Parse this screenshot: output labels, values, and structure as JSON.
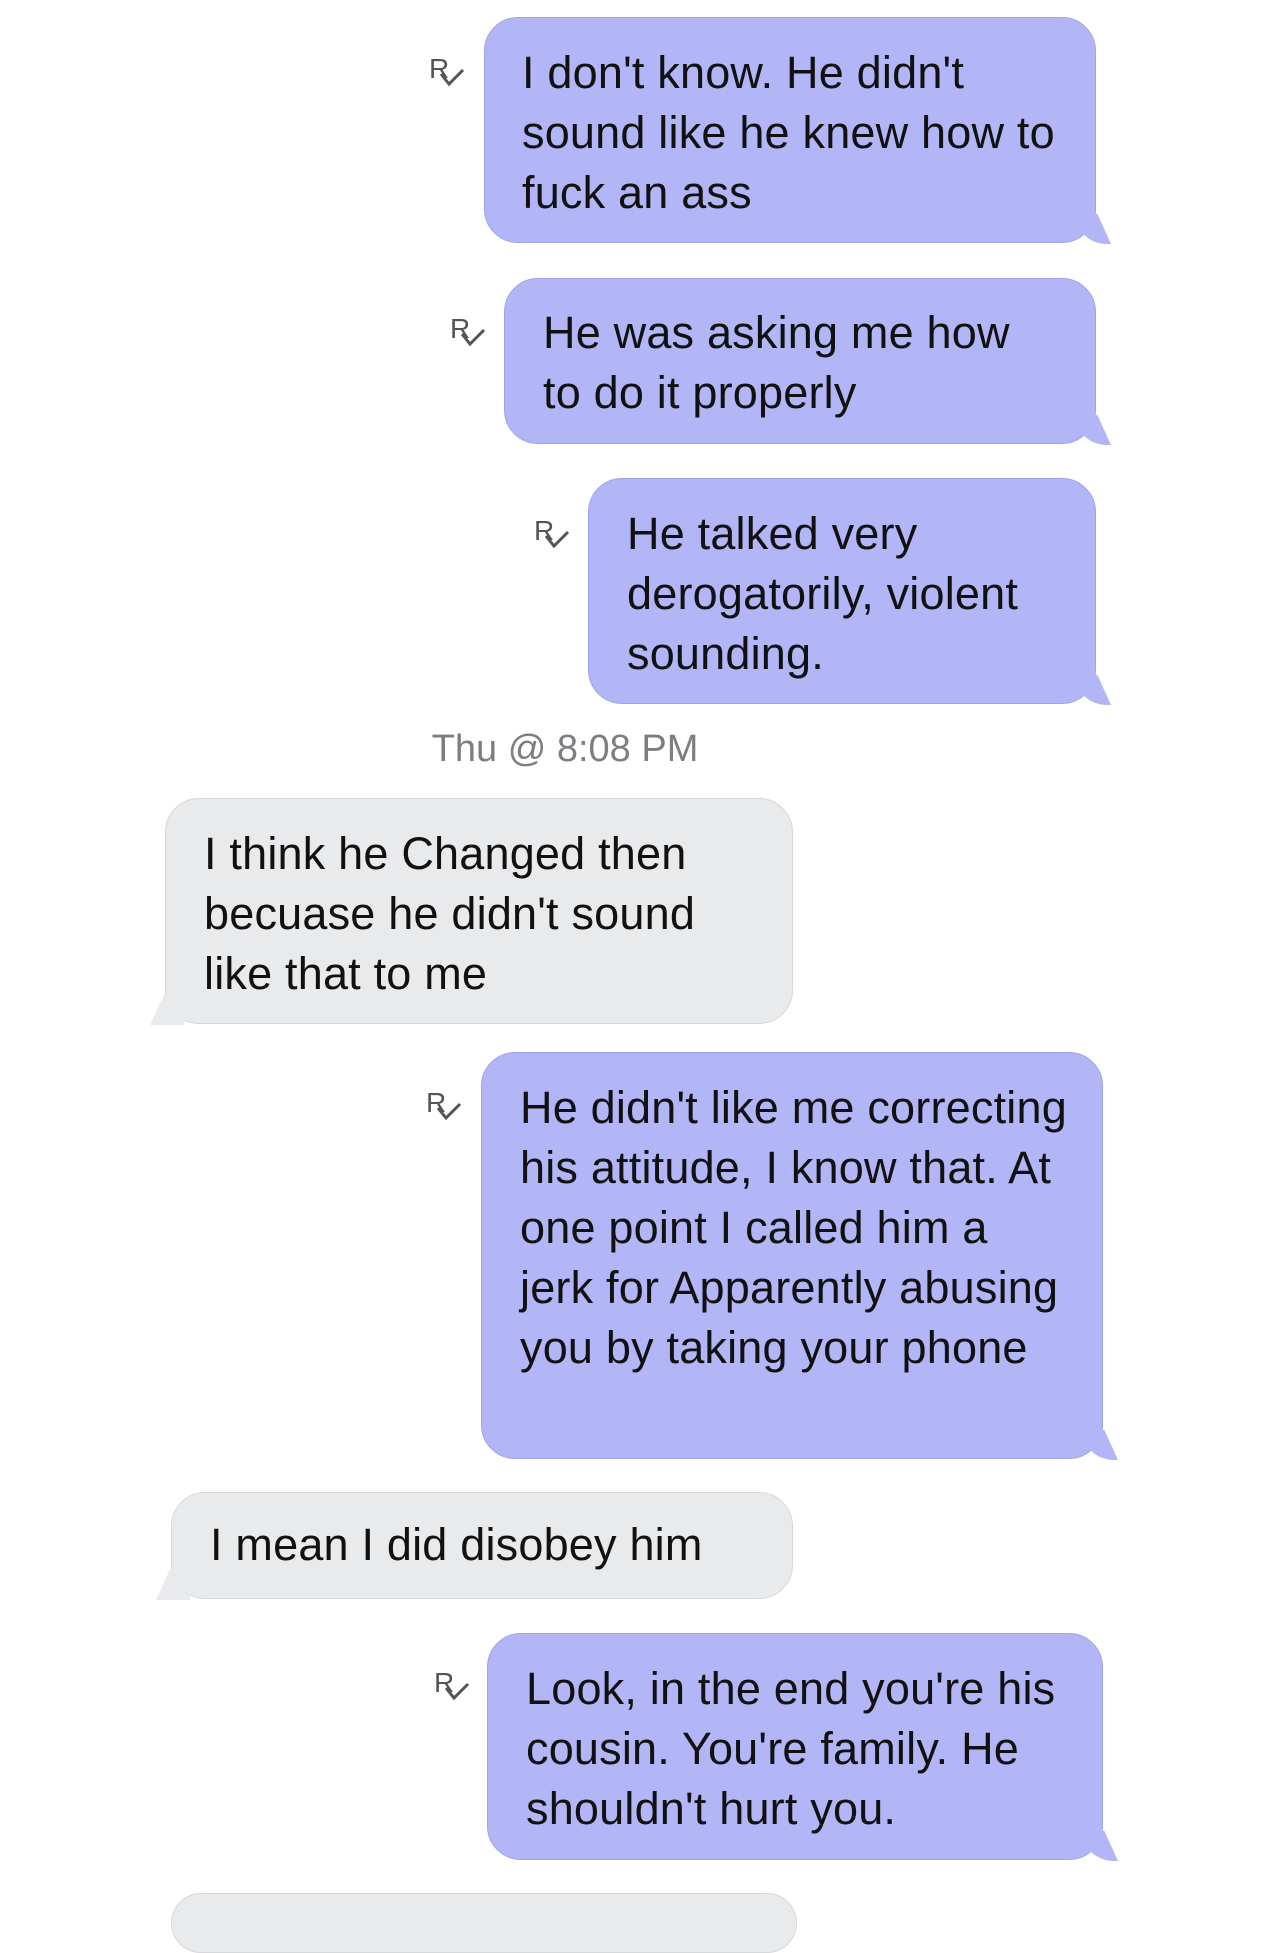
{
  "messages": [
    {
      "direction": "out",
      "receipt": "read-receipt-icon",
      "text": "I don't know. He didn't sound like he knew how to fuck an ass"
    },
    {
      "direction": "out",
      "receipt": "read-receipt-icon",
      "text": "He was asking me how to do it properly"
    },
    {
      "direction": "out",
      "receipt": "read-receipt-icon",
      "text": "He talked very derogatorily, violent sounding."
    },
    {
      "direction": "in",
      "text": "I think he Changed then becuase he didn't sound like that to me"
    },
    {
      "direction": "out",
      "receipt": "read-receipt-icon",
      "text": "He didn't like me correcting his attitude, I know that. At one point I called him a jerk for Apparently abusing you by taking your phone"
    },
    {
      "direction": "in",
      "text": "I mean I did disobey him"
    },
    {
      "direction": "out",
      "receipt": "read-receipt-icon",
      "text": "Look, in the end you're his cousin. You're family. He shouldn't hurt you."
    }
  ],
  "timestamp": "Thu @ 8:08 PM",
  "colors": {
    "outgoing_bubble": "#b2b5f6",
    "incoming_bubble": "#e9eaec",
    "timestamp_text": "#7d7d82"
  }
}
